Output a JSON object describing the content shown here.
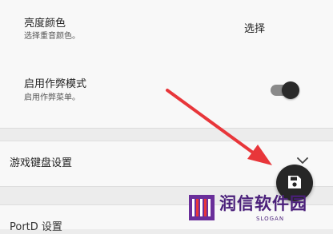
{
  "settings": {
    "highlight_color": {
      "title": "亮度颜色",
      "subtitle": "选择重音颜色。",
      "action_label": "选择"
    },
    "cheat_mode": {
      "title": "启用作弊模式",
      "subtitle": "启用作弊菜单。",
      "enabled": true
    }
  },
  "keyboard_section": {
    "label": "游戏键盘设置"
  },
  "next_section": {
    "label": "PortD 设置"
  },
  "fab": {
    "icon": "save-icon"
  },
  "annotation": {
    "arrow_color": "#e8363a"
  },
  "watermark": {
    "text": "润信软件园",
    "slogan": "SLOGAN",
    "color": "#4a1f7a"
  },
  "colors": {
    "background": "#ececec",
    "card": "#f8f8f8",
    "toggle_track": "#8a8a8a",
    "toggle_thumb": "#2a2a2a",
    "fab": "#262626"
  }
}
